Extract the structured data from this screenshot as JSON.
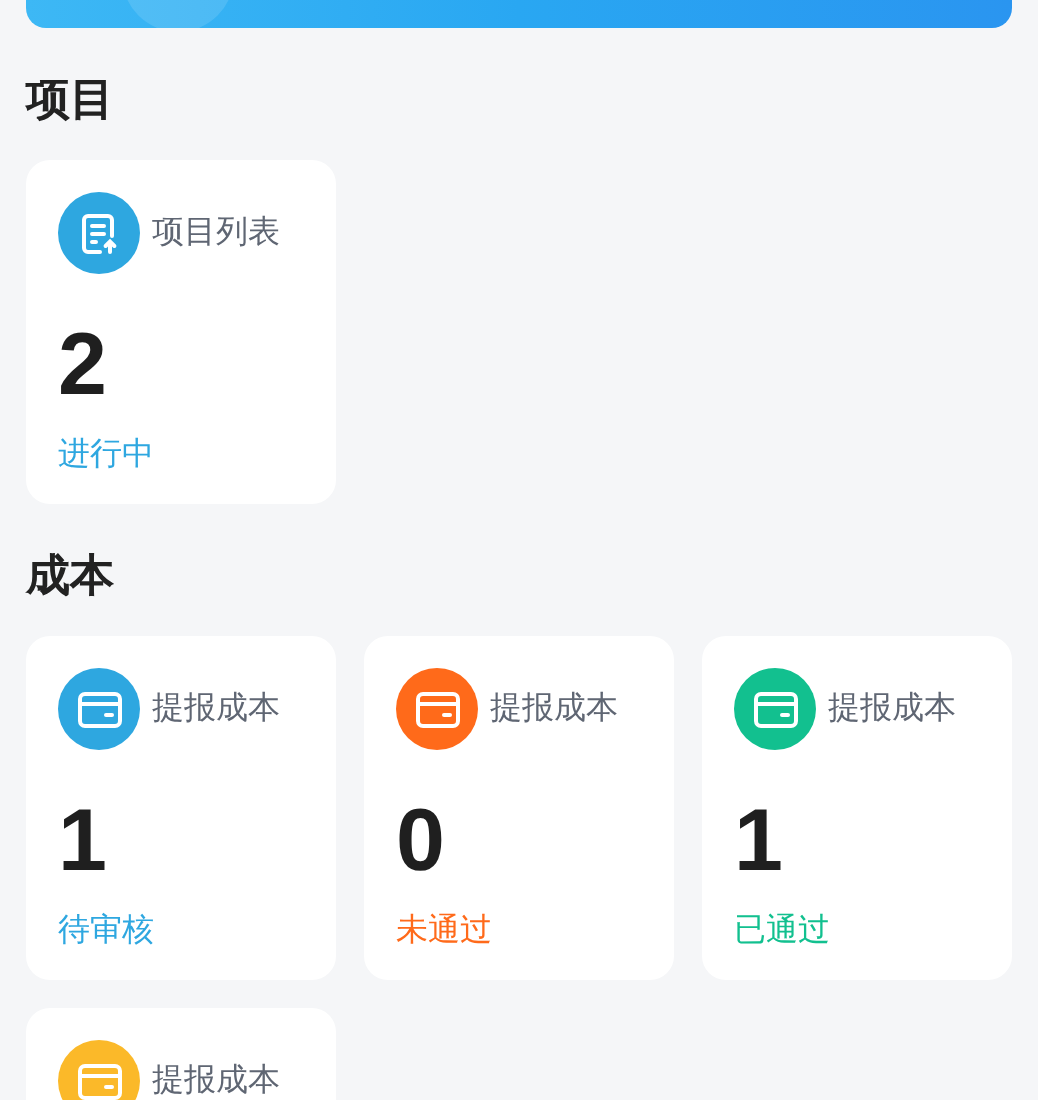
{
  "sections": [
    {
      "title": "项目",
      "cards": [
        {
          "kind": "document",
          "color": "#2ea7e0",
          "label": "项目列表",
          "count": "2",
          "status": "进行中"
        }
      ]
    },
    {
      "title": "成本",
      "cards": [
        {
          "kind": "wallet",
          "color": "#2ea7e0",
          "label": "提报成本",
          "count": "1",
          "status": "待审核"
        },
        {
          "kind": "wallet",
          "color": "#ff6a1a",
          "label": "提报成本",
          "count": "0",
          "status": "未通过"
        },
        {
          "kind": "wallet",
          "color": "#12c08f",
          "label": "提报成本",
          "count": "1",
          "status": "已通过"
        },
        {
          "kind": "wallet",
          "color": "#fbb929",
          "label": "提报成本"
        }
      ]
    }
  ]
}
